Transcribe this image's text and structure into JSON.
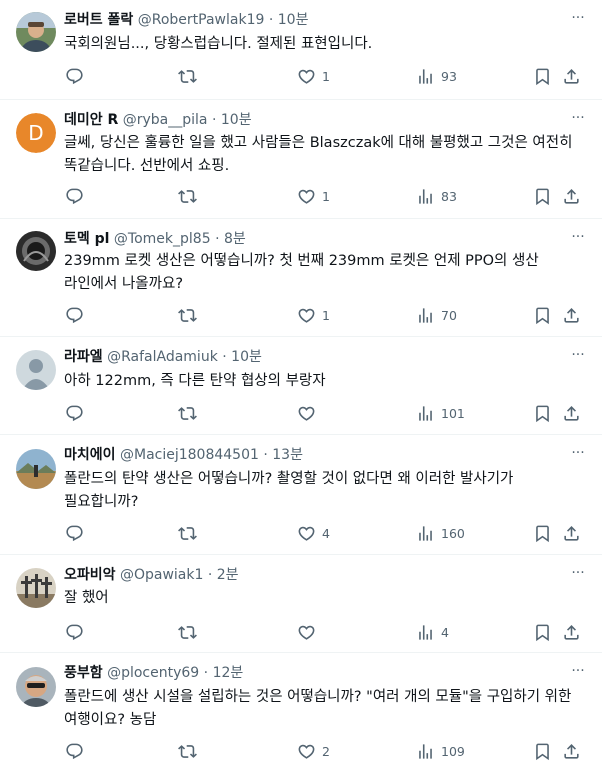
{
  "tweets": [
    {
      "name": "로버트 폴락",
      "handle": "@RobertPawlak19",
      "dot": "·",
      "time": "10분",
      "text": "국회의원님..., 당황스럽습니다. 절제된 표현입니다.",
      "replies": "",
      "retweets": "",
      "likes": "1",
      "views": "93",
      "avatar": "avatar-photo-man-outdoors"
    },
    {
      "name": "데미안 R",
      "handle": "@ryba__pila",
      "dot": "·",
      "time": "10분",
      "text": "글쎄, 당신은 훌륭한 일을 했고 사람들은 Blaszczak에 대해 불평했고 그것은 여전히 똑같습니다. 선반에서 쇼핑.",
      "replies": "",
      "retweets": "",
      "likes": "1",
      "views": "83",
      "avatar_letter": "D",
      "avatar_color": "#e8872a"
    },
    {
      "name": "토멕 pl",
      "handle": "@Tomek_pl85",
      "dot": "·",
      "time": "8분",
      "text": "239mm 로켓 생산은 어떻습니까? 첫 번째 239mm 로켓은 언제 PPO의 생산 라인에서 나올까요?",
      "replies": "",
      "retweets": "",
      "likes": "1",
      "views": "70",
      "avatar": "avatar-photo-dark-helmet"
    },
    {
      "name": "라파엘",
      "handle": "@RafalAdamiuk",
      "dot": "·",
      "time": "10분",
      "text": "아하 122mm, 즉 다른 탄약 협상의 부랑자",
      "replies": "",
      "retweets": "",
      "likes": "",
      "views": "101",
      "avatar": "avatar-default-silhouette"
    },
    {
      "name": "마치에이",
      "handle": "@Maciej180844501",
      "dot": "·",
      "time": "13분",
      "text": "폴란드의 탄약 생산은 어떻습니까? 촬영할 것이 없다면 왜 이러한 발사기가 필요합니까?",
      "replies": "",
      "retweets": "",
      "likes": "4",
      "views": "160",
      "avatar": "avatar-photo-landscape"
    },
    {
      "name": "오파비악",
      "handle": "@Opawiak1",
      "dot": "·",
      "time": "2분",
      "text": "잘 했어",
      "replies": "",
      "retweets": "",
      "likes": "",
      "views": "4",
      "avatar": "avatar-photo-crosses"
    },
    {
      "name": "풍부함",
      "handle": "@plocenty69",
      "dot": "·",
      "time": "12분",
      "text": "폴란드에 생산 시설을 설립하는 것은 어떻습니까? \"여러 개의 모듈\"을 구입하기 위한 여행이요? 농담",
      "replies": "",
      "retweets": "",
      "likes": "2",
      "views": "109",
      "avatar": "avatar-photo-man-sunglasses"
    }
  ],
  "more_glyph": "···",
  "colors": {
    "muted": "#536471",
    "text": "#0f1419",
    "divider": "#eff3f4"
  }
}
